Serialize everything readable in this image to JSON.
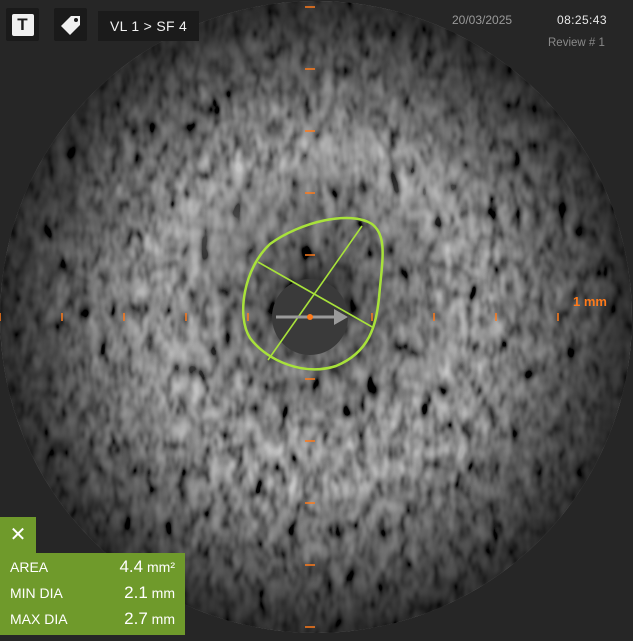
{
  "toolbar": {
    "text_tool_glyph": "T",
    "vessel_segment": "VL 1 > SF 4"
  },
  "header": {
    "date": "20/03/2025",
    "time": "08:25:43",
    "review": "Review # 1"
  },
  "scale": {
    "label": "1 mm",
    "color": "#ff7a1a"
  },
  "measurements": {
    "close_glyph": "✕",
    "accent_color": "#6f9a2b",
    "contour_color": "#a8e23a",
    "rows": [
      {
        "label": "AREA",
        "value": "4.4",
        "unit": "mm²"
      },
      {
        "label": "MIN DIA",
        "value": "2.1",
        "unit": "mm"
      },
      {
        "label": "MAX DIA",
        "value": "2.7",
        "unit": "mm"
      }
    ]
  },
  "icons": {
    "text_tool": "text-tool-icon",
    "tag_tool": "tag-icon",
    "catheter_direction": "arrow-right-icon"
  }
}
